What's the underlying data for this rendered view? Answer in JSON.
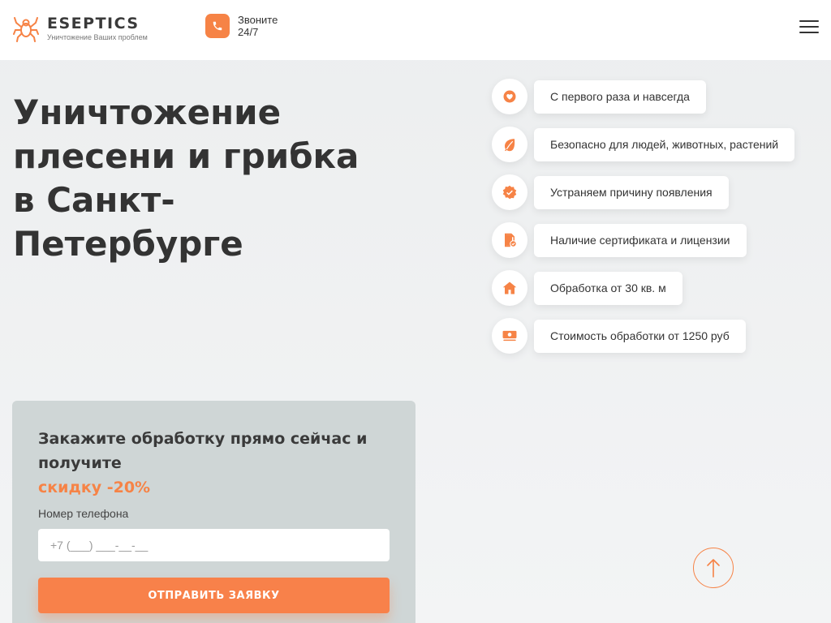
{
  "header": {
    "logo_title": "ESEPTICS",
    "logo_subtitle": "Уничтожение Ваших проблем",
    "call_line1": "Звоните",
    "call_line2": "24/7"
  },
  "hero": {
    "title": "Уничтожение плесени и грибка в Санкт-Петербурге"
  },
  "features": [
    {
      "icon": "heart-icon",
      "label": "С первого раза и навсегда"
    },
    {
      "icon": "leaf-icon",
      "label": "Безопасно для людей, животных, растений"
    },
    {
      "icon": "check-badge-icon",
      "label": "Устраняем причину появления"
    },
    {
      "icon": "certificate-icon",
      "label": "Наличие сертификата и лицензии"
    },
    {
      "icon": "house-icon",
      "label": "Обработка от 30 кв. м"
    },
    {
      "icon": "money-icon",
      "label": "Стоимость обработки от 1250 руб"
    }
  ],
  "order": {
    "title": "Закажите обработку прямо сейчас и получите",
    "discount": "скидку -20%",
    "phone_label": "Номер телефона",
    "phone_placeholder": "+7 (___) ___-__-__",
    "submit_label": "ОТПРАВИТЬ ЗАЯВКУ"
  },
  "colors": {
    "accent": "#f68346",
    "form_bg": "#cfd6d6"
  }
}
